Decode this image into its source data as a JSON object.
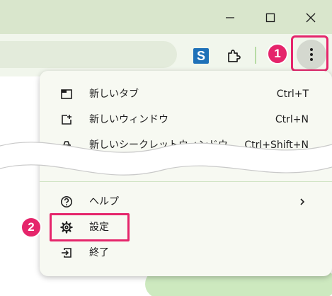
{
  "colors": {
    "titlebar": "#d9e6cc",
    "toolbar": "#f1f6ec",
    "menu_bg": "#f7f9f2",
    "highlight": "#e5256b",
    "accent_green": "#cde9bf"
  },
  "window_controls": {
    "minimize_icon": "minimize-icon",
    "maximize_icon": "maximize-icon",
    "close_icon": "close-icon"
  },
  "toolbar": {
    "extension_s_label": "S",
    "extensions_icon": "puzzle-icon",
    "more_icon": "kebab-icon"
  },
  "annotations": {
    "step1": "1",
    "step2": "2"
  },
  "menu": {
    "items_top": [
      {
        "label": "新しいタブ",
        "shortcut": "Ctrl+T",
        "icon": "new-tab-icon"
      },
      {
        "label": "新しいウィンドウ",
        "shortcut": "Ctrl+N",
        "icon": "new-window-icon"
      },
      {
        "label": "新しいシークレットウィンドウ",
        "shortcut": "Ctrl+Shift+N",
        "icon": "incognito-icon"
      }
    ],
    "items_bottom": [
      {
        "label": "ヘルプ",
        "icon": "help-icon",
        "submenu": true
      },
      {
        "label": "設定",
        "icon": "gear-icon"
      },
      {
        "label": "終了",
        "icon": "exit-icon"
      }
    ]
  }
}
